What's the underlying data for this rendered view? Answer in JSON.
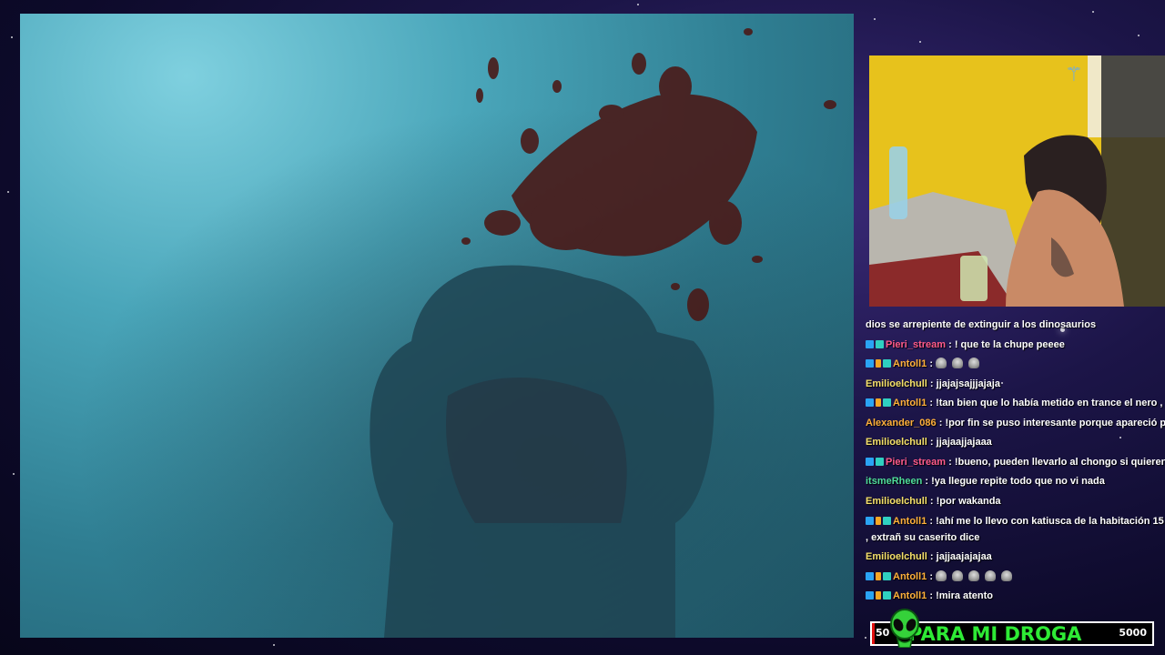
{
  "chat": [
    {
      "badges": [],
      "user": "",
      "user_color": "#ffffff",
      "text": "dios se arrepiente de extinguir a los dinosaurios"
    },
    {
      "badges": [
        "blue",
        "teal"
      ],
      "user": "Pieri_stream",
      "user_color": "#ff5b8a",
      "text": ": ! que te la chupe peeee"
    },
    {
      "badges": [
        "blue",
        "small",
        "teal"
      ],
      "user": "Antoll1",
      "user_color": "#ffb03a",
      "text": ":",
      "emotes": 3
    },
    {
      "badges": [],
      "user": "Emilioelchull",
      "user_color": "#f5e06a",
      "text": ": jjajajsajjjajaja"
    },
    {
      "badges": [
        "blue",
        "small",
        "teal"
      ],
      "user": "Antoll1",
      "user_color": "#ffb03a",
      "text": ": !tan bien que lo había metido en trance el nero , lo cagar"
    },
    {
      "badges": [],
      "user": "Alexander_086",
      "user_color": "#ffb03a",
      "text": ": !por fin se puso interesante porque apareció pingawyse"
    },
    {
      "badges": [],
      "user": "Emilioelchull",
      "user_color": "#f5e06a",
      "text": ": jjajaajjajaaa"
    },
    {
      "badges": [
        "blue",
        "teal"
      ],
      "user": "Pieri_stream",
      "user_color": "#ff5b8a",
      "text": ": !bueno, pueden llevarlo al chongo si quieren, está sol"
    },
    {
      "badges": [],
      "user": "itsmeRheen",
      "user_color": "#4fdc9a",
      "text": ": !ya llegue repite todo que no vi nada"
    },
    {
      "badges": [],
      "user": "Emilioelchull",
      "user_color": "#f5e06a",
      "text": ": !por wakanda"
    },
    {
      "badges": [
        "blue",
        "small",
        "teal"
      ],
      "user": "Antoll1",
      "user_color": "#ffb03a",
      "text": ": !ahí me lo llevo con katiusca de la habitación 15 , extrañ su caserito dice",
      "wrap": true
    },
    {
      "badges": [],
      "user": "Emilioelchull",
      "user_color": "#f5e06a",
      "text": ": jajjaajajajaa"
    },
    {
      "badges": [
        "blue",
        "small",
        "teal"
      ],
      "user": "Antoll1",
      "user_color": "#ffb03a",
      "text": ":",
      "emotes": 5
    },
    {
      "badges": [
        "blue",
        "small",
        "teal"
      ],
      "user": "Antoll1",
      "user_color": "#ffb03a",
      "text": ": !mira atento"
    }
  ],
  "goal": {
    "title": "PARA MI DROGA",
    "start": "50",
    "end": "5000",
    "progress": 0.01,
    "fill_color": "#e01010",
    "title_color": "#2eea35"
  },
  "icons": {
    "alien": "alien-icon",
    "emote": "skull-emote-icon"
  }
}
